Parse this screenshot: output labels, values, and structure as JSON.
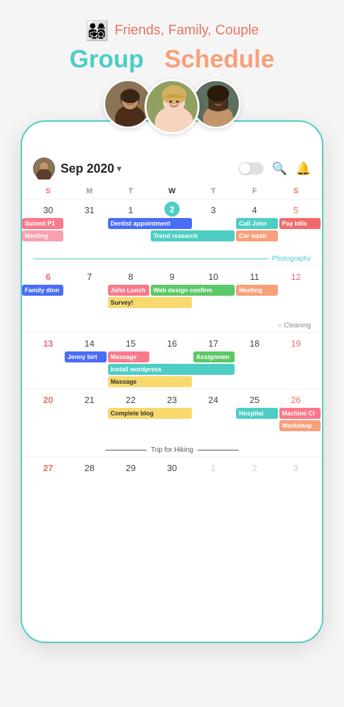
{
  "app": {
    "emoji": "👨‍👩‍👧‍👦",
    "subtitle": "Friends, Family, Couple",
    "title_green": "Group",
    "title_orange": "Schedule"
  },
  "header": {
    "month": "Sep 2020",
    "chevron": "▾"
  },
  "weekdays": [
    "S",
    "M",
    "T",
    "W",
    "T",
    "F",
    "S"
  ],
  "weeks": [
    {
      "days": [
        30,
        31,
        1,
        2,
        3,
        4,
        5
      ],
      "types": [
        "prev",
        "prev",
        "normal",
        "today",
        "normal",
        "normal",
        "normal"
      ]
    },
    {
      "days": [
        6,
        7,
        8,
        9,
        10,
        11,
        12
      ],
      "types": [
        "sunday",
        "normal",
        "normal",
        "normal",
        "normal",
        "normal",
        "normal"
      ]
    },
    {
      "days": [
        13,
        14,
        15,
        16,
        17,
        18,
        19
      ],
      "types": [
        "sunday",
        "normal",
        "normal",
        "normal",
        "normal",
        "normal",
        "normal"
      ]
    },
    {
      "days": [
        20,
        21,
        22,
        23,
        24,
        25,
        26
      ],
      "types": [
        "sunday",
        "normal",
        "normal",
        "normal",
        "normal",
        "normal",
        "normal"
      ]
    },
    {
      "days": [
        27,
        28,
        29,
        30,
        1,
        2,
        3
      ],
      "types": [
        "sunday",
        "normal",
        "normal",
        "normal",
        "next",
        "next",
        "next"
      ]
    }
  ],
  "events": {
    "week1": [
      {
        "label": "Submit P1",
        "col": 0,
        "span": 1,
        "color": "c-pink",
        "row": 0
      },
      {
        "label": "Meeting",
        "col": 0,
        "span": 1,
        "color": "c-pink-light",
        "row": 1
      },
      {
        "label": "Dentist appointment",
        "col": 2,
        "span": 2,
        "color": "c-blue-dark",
        "row": 0
      },
      {
        "label": "Trend research",
        "col": 3,
        "span": 2,
        "color": "c-teal",
        "row": 1
      },
      {
        "label": "Call John",
        "col": 5,
        "span": 1,
        "color": "c-teal",
        "row": 0
      },
      {
        "label": "Car wash",
        "col": 5,
        "span": 1,
        "color": "c-orange",
        "row": 1
      },
      {
        "label": "Pay bills",
        "col": 6,
        "span": 1,
        "color": "c-red-orange",
        "row": 0
      }
    ],
    "week2": [
      {
        "label": "Family dinn",
        "col": 0,
        "span": 1,
        "color": "c-blue-dark",
        "row": 0
      },
      {
        "label": "John Lunch",
        "col": 2,
        "span": 1,
        "color": "c-pink",
        "row": 0
      },
      {
        "label": "Web design confirm",
        "col": 3,
        "span": 2,
        "color": "c-green",
        "row": 0
      },
      {
        "label": "Survey!",
        "col": 2,
        "span": 2,
        "color": "c-yellow",
        "row": 1
      },
      {
        "label": "Meeting",
        "col": 5,
        "span": 1,
        "color": "c-orange",
        "row": 0
      }
    ],
    "week3": [
      {
        "label": "Jenny birt",
        "col": 1,
        "span": 1,
        "color": "c-blue-dark",
        "row": 0
      },
      {
        "label": "Massage",
        "col": 2,
        "span": 1,
        "color": "c-pink",
        "row": 0
      },
      {
        "label": "Assignmen",
        "col": 4,
        "span": 1,
        "color": "c-green",
        "row": 0
      },
      {
        "label": "Install wordpress",
        "col": 2,
        "span": 3,
        "color": "c-teal",
        "row": 1
      },
      {
        "label": "Massage",
        "col": 2,
        "span": 2,
        "color": "c-yellow",
        "row": 2
      }
    ],
    "week4": [
      {
        "label": "Complete blog",
        "col": 2,
        "span": 2,
        "color": "c-yellow",
        "row": 0
      },
      {
        "label": "Hospital",
        "col": 5,
        "span": 1,
        "color": "c-teal",
        "row": 0
      },
      {
        "label": "Machine Cl",
        "col": 6,
        "span": 1,
        "color": "c-pink",
        "row": 0
      },
      {
        "label": "Workshop",
        "col": 6,
        "span": 1,
        "color": "c-orange",
        "row": 1
      }
    ]
  },
  "cleaning": "○ Cleaning",
  "photography": "Photography",
  "hiking": "Trip for Hiking"
}
